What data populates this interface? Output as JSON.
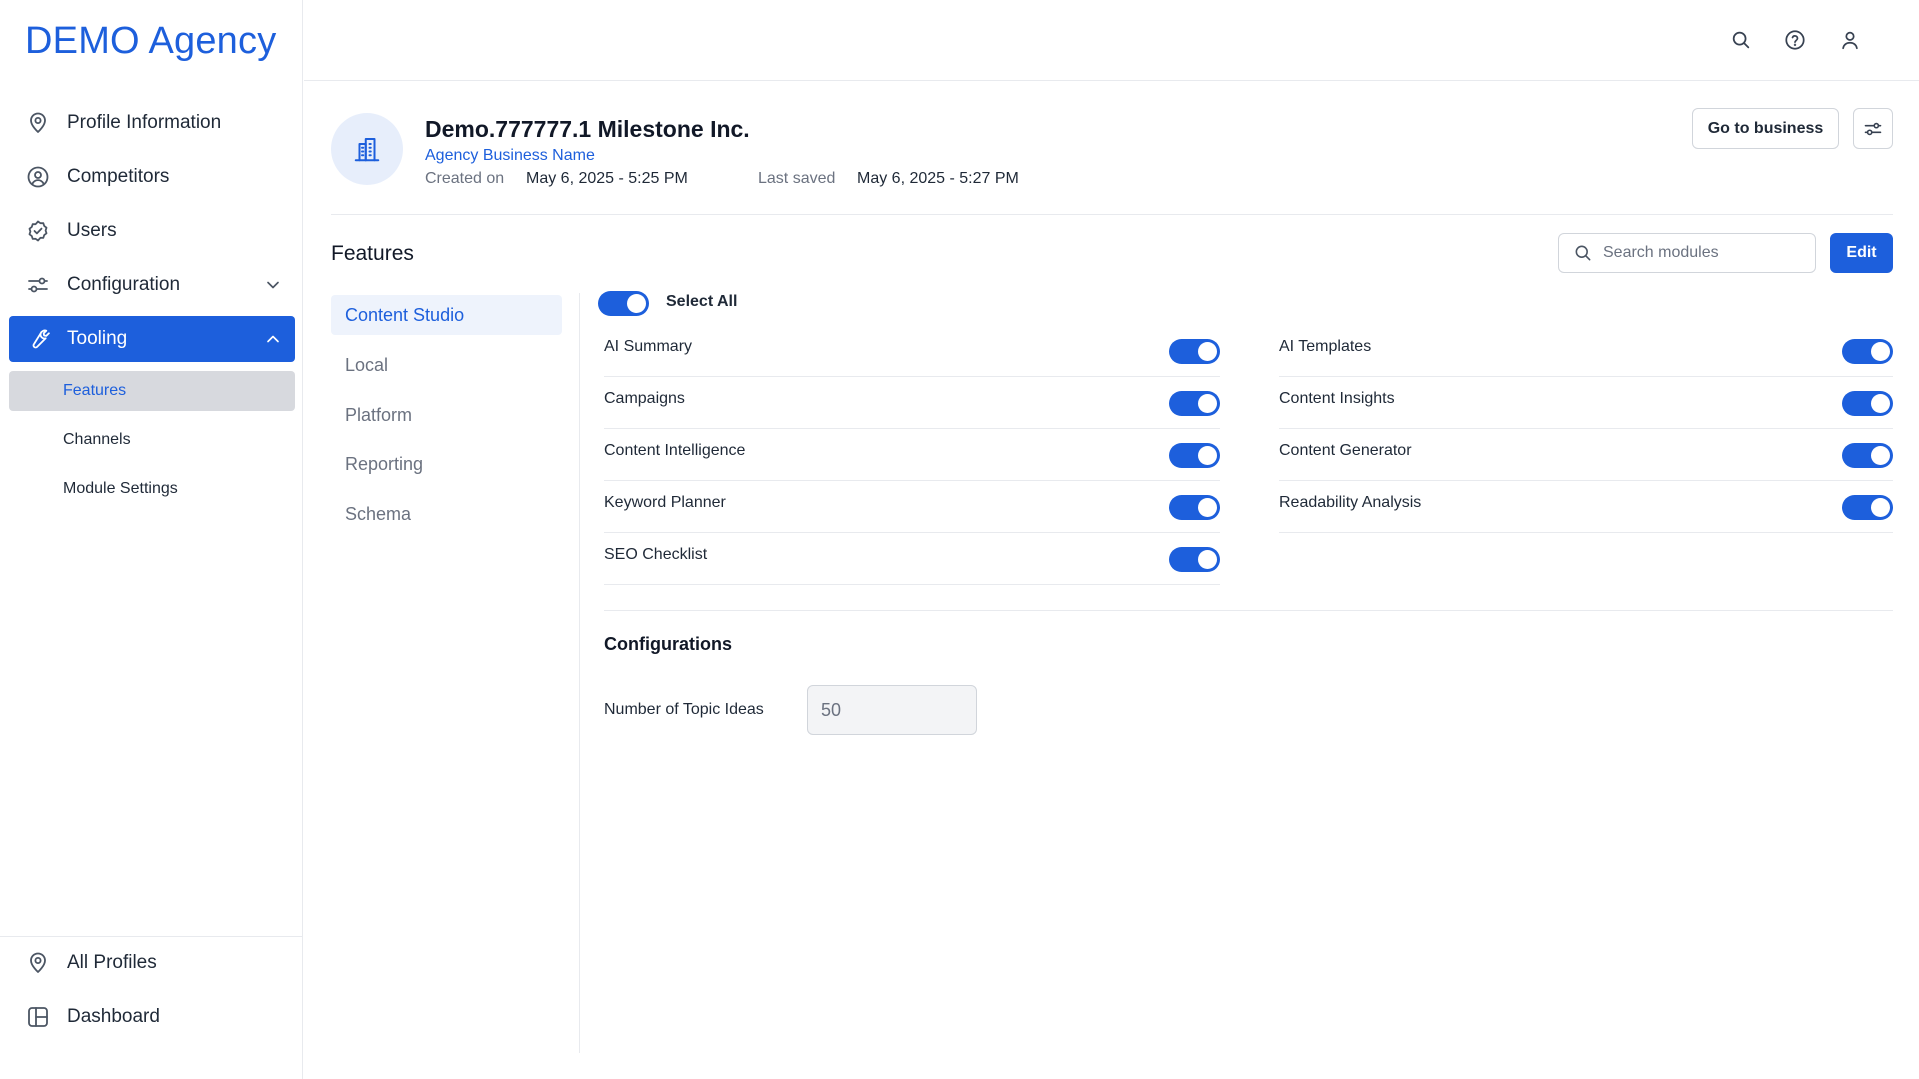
{
  "app": {
    "logo": "DEMO Agency"
  },
  "sidebar": {
    "items": [
      {
        "label": "Profile Information",
        "icon": "map-pin-icon"
      },
      {
        "label": "Competitors",
        "icon": "user-circle-icon"
      },
      {
        "label": "Users",
        "icon": "badge-check-icon"
      },
      {
        "label": "Configuration",
        "icon": "sliders-icon",
        "expanded": false
      },
      {
        "label": "Tooling",
        "icon": "wrench-icon",
        "expanded": true,
        "active": true
      }
    ],
    "sub_items": [
      {
        "label": "Features",
        "active": true
      },
      {
        "label": "Channels"
      },
      {
        "label": "Module Settings"
      }
    ],
    "bottom_items": [
      {
        "label": "All Profiles",
        "icon": "map-pin-icon"
      },
      {
        "label": "Dashboard",
        "icon": "layout-icon"
      }
    ]
  },
  "topbar": {
    "icons": [
      "search-icon",
      "help-icon",
      "user-icon"
    ]
  },
  "business": {
    "name": "Demo.777777.1 Milestone Inc.",
    "subtitle": "Agency Business Name",
    "created_label": "Created on",
    "created_value": "May 6, 2025 - 5:25 PM",
    "saved_label": "Last saved",
    "saved_value": "May 6, 2025 - 5:27 PM",
    "go_button": "Go to business"
  },
  "features": {
    "title": "Features",
    "search_placeholder": "Search modules",
    "edit_label": "Edit",
    "categories": [
      "Content Studio",
      "Local",
      "Platform",
      "Reporting",
      "Schema"
    ],
    "active_category": "Content Studio",
    "select_all_label": "Select All",
    "select_all_on": true,
    "left_items": [
      {
        "label": "AI Summary",
        "on": true
      },
      {
        "label": "Campaigns",
        "on": true
      },
      {
        "label": "Content Intelligence",
        "on": true
      },
      {
        "label": "Keyword Planner",
        "on": true
      },
      {
        "label": "SEO Checklist",
        "on": true
      }
    ],
    "right_items": [
      {
        "label": "AI Templates",
        "on": true
      },
      {
        "label": "Content Insights",
        "on": true
      },
      {
        "label": "Content Generator",
        "on": true
      },
      {
        "label": "Readability Analysis",
        "on": true
      }
    ]
  },
  "configurations": {
    "title": "Configurations",
    "topic_ideas_label": "Number of Topic Ideas",
    "topic_ideas_value": "50"
  },
  "colors": {
    "accent": "#1d5fdc",
    "active_sub_bg": "#d7d9de",
    "category_active_bg": "#eef3fc"
  }
}
